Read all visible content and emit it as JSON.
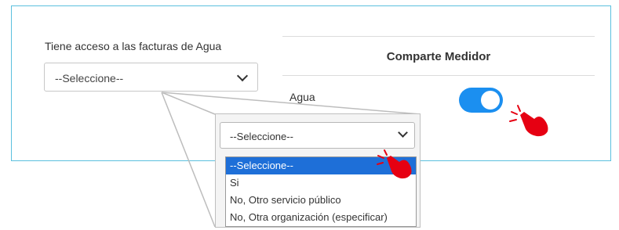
{
  "form": {
    "question_label": "Tiene acceso a las facturas de Agua",
    "select_value": "--Seleccione--"
  },
  "compare": {
    "title": "Comparte Medidor",
    "agua_label": "Agua",
    "toggle_on": true
  },
  "dropdown": {
    "value": "--Seleccione--",
    "options": [
      {
        "label": "--Seleccione--",
        "selected": true
      },
      {
        "label": "Si",
        "selected": false
      },
      {
        "label": "No, Otro servicio público",
        "selected": false
      },
      {
        "label": "No, Otra organización (especificar)",
        "selected": false
      }
    ]
  },
  "colors": {
    "panel_border": "#5bc0de",
    "toggle_on": "#1b8ff0",
    "option_selected": "#1e6fd8",
    "pointer_hand": "#e60012"
  },
  "icons": [
    "chevron-down-icon",
    "pointer-hand-icon"
  ]
}
